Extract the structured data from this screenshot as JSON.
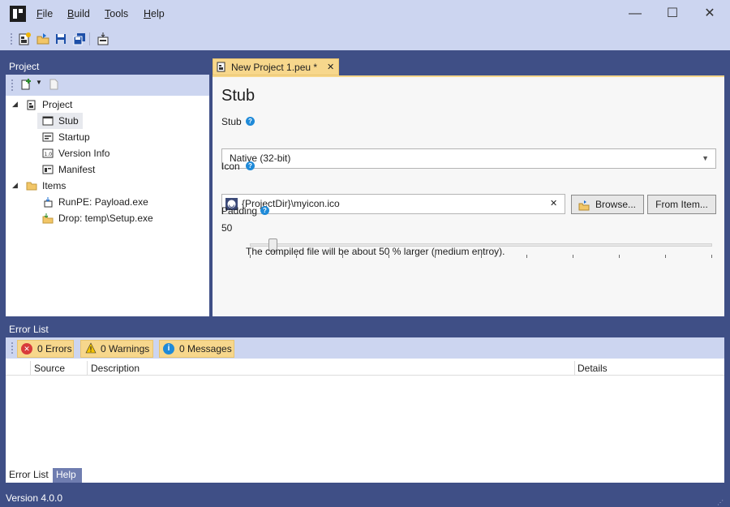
{
  "menu": {
    "file": "File",
    "file_u": "F",
    "file_rest": "ile",
    "build_u": "B",
    "build_rest": "uild",
    "tools_u": "T",
    "tools_rest": "ools",
    "help_u": "H",
    "help_rest": "elp"
  },
  "window": {
    "minimize": "—",
    "maximize": "☐",
    "close": "✕"
  },
  "project_panel": {
    "title": "Project",
    "tree": [
      {
        "label": "Project",
        "icon": "project-icon"
      },
      {
        "label": "Stub",
        "icon": "window-icon",
        "selected": true
      },
      {
        "label": "Startup",
        "icon": "startup-icon"
      },
      {
        "label": "Version Info",
        "icon": "version-info-icon"
      },
      {
        "label": "Manifest",
        "icon": "manifest-icon"
      },
      {
        "label": "Items",
        "icon": "folder-icon"
      },
      {
        "label": "RunPE: Payload.exe",
        "icon": "runpe-icon"
      },
      {
        "label": "Drop: temp\\Setup.exe",
        "icon": "drop-icon"
      }
    ]
  },
  "document": {
    "tab_title": "New Project 1.peu *",
    "tab_close": "✕",
    "heading": "Stub",
    "stub_label": "Stub",
    "stub_value": "Native (32-bit)",
    "icon_label": "Icon",
    "icon_path": "{ProjectDir}\\myicon.ico",
    "clear_glyph": "✕",
    "browse_label": "Browse...",
    "from_item_label": "From Item...",
    "padding_label": "Padding",
    "padding_value": "50",
    "padding_level": 0.05,
    "padding_note": "The compiled file will be about 50 % larger (medium entroy).",
    "help_glyph": "?"
  },
  "error_list": {
    "title": "Error List",
    "errors": "0 Errors",
    "warnings": "0 Warnings",
    "messages": "0 Messages",
    "columns": [
      "Source",
      "Description",
      "Details"
    ],
    "bottom_tabs": [
      "Error List",
      "Help"
    ]
  },
  "status": {
    "version": "Version 4.0.0"
  },
  "colors": {
    "accent": "#3f4f86",
    "chrome": "#ccd5f0",
    "tab_active": "#f7d78c"
  }
}
